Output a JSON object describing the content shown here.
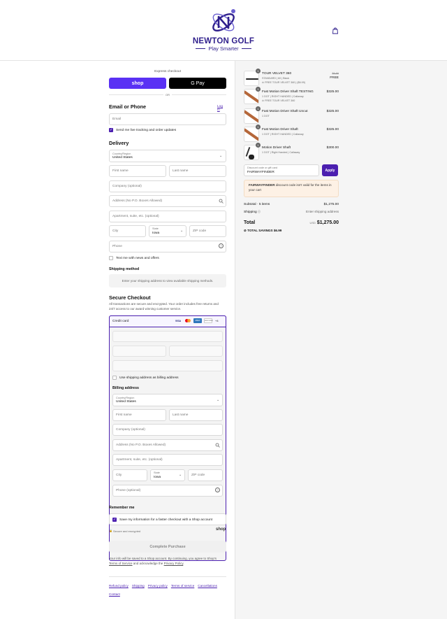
{
  "header": {
    "brand_name": "NEWTON GOLF",
    "tagline": "Play Smarter",
    "brand_color": "#2f1f8c",
    "cart_icon": "shopping-bag-icon"
  },
  "express": {
    "title": "Express checkout",
    "shop_label": "shop",
    "gpay_label": "G Pay",
    "or_label": "OR",
    "shop_color": "#5a31f4"
  },
  "contact": {
    "title": "Email or Phone",
    "login_label": "Log in",
    "email_placeholder": "Email",
    "tracking_label": "Send me live tracking and order updates"
  },
  "delivery": {
    "title": "Delivery",
    "country_label": "Country/Region",
    "country_value": "United States",
    "first_name": "First name",
    "last_name": "Last name",
    "company": "Company (optional)",
    "address": "Address (No P.O. Boxes Allowed)",
    "apartment": "Apartment, suite, etc. (optional)",
    "city": "City",
    "state_label": "State",
    "state_value": "Iowa",
    "zip": "ZIP code",
    "phone": "Phone",
    "text_offers": "Text me with news and offers"
  },
  "shipping_method": {
    "title": "Shipping method",
    "notice": "Enter your shipping address to view available shipping methods."
  },
  "payment": {
    "title": "Secure Checkout",
    "description": "All transactions are secure and encrypted. Your order includes free returns and 24/7 access to our award winning customer service.",
    "credit_card_label": "Credit card",
    "card_brands": [
      "VISA",
      "MC",
      "AMEX",
      "DISCOVER",
      "+4"
    ],
    "use_shipping_label": "Use shipping address as billing address"
  },
  "billing": {
    "title": "Billing address",
    "country_label": "Country/Region",
    "country_value": "United States",
    "first_name": "First name",
    "last_name": "Last name",
    "company": "Company (optional)",
    "address": "Address (No P.O. Boxes Allowed)",
    "apartment": "Apartment, suite, etc. (optional)",
    "city": "City",
    "state_label": "State",
    "state_value": "Iowa",
    "zip": "ZIP code",
    "phone": "Phone (optional)"
  },
  "remember": {
    "title": "Remember me",
    "save_label": "Save my information for a faster checkout with a Shop account",
    "secure_label": "Secure and encrypted",
    "shop_label": "shop"
  },
  "complete_button": "Complete Purchase",
  "legal": {
    "text_1": "Your info will be saved to a Shop account. By continuing, you agree to Shop's",
    "terms": "Terms of Service",
    "text_2": "and acknowledge the",
    "privacy": "Privacy Policy",
    "text_3": "."
  },
  "footer_links": [
    "Refund policy",
    "Shipping",
    "Privacy policy",
    "Terms of service",
    "Cancellations",
    "Contact"
  ],
  "order": {
    "items": [
      {
        "qty": "1",
        "name": "TOUR VELVET 360",
        "sub1": "STANDARD | 60 | Black",
        "sub2": "FREE TOUR VELVET 360 | ($6.99)",
        "price_strike": "$6.99",
        "price": "FREE"
      },
      {
        "qty": "1",
        "name": "Fast Motion Driver Shaft TESTING",
        "sub1": "1 DOT | RIGHT HANDED | Callaway",
        "sub2": "FREE TOUR VELVET 360",
        "price_strike": "",
        "price": "$325.00"
      },
      {
        "qty": "1",
        "name": "Fast Motion Driver Shaft Uncut",
        "sub1": "1 DOT",
        "sub2": "",
        "price_strike": "",
        "price": "$325.00"
      },
      {
        "qty": "1",
        "name": "Fast Motion Driver Shaft",
        "sub1": "1 DOT | RIGHT HANDED | Callaway",
        "sub2": "",
        "price_strike": "",
        "price": "$325.00"
      },
      {
        "qty": "1",
        "name": "Motion Driver Shaft",
        "sub1": "1 DOT | Right Handed | Callaway",
        "sub2": "",
        "price_strike": "",
        "price": "$300.00"
      }
    ],
    "discount_label": "Discount code or gift card",
    "discount_value": "FAIRWAYFINDER",
    "apply_label": "Apply",
    "error_code": "FAIRWAYFINDER",
    "error_text": "discount code isn't valid for the items in your cart",
    "subtotal_label": "Subtotal · 5 items",
    "subtotal_value": "$1,275.00",
    "shipping_label": "Shipping",
    "shipping_value": "Enter shipping address",
    "total_label": "Total",
    "currency": "USD",
    "total_value": "$1,275.00",
    "savings_label": "TOTAL SAVINGS",
    "savings_value": "$6.99",
    "accent": "#4b1fb0"
  }
}
